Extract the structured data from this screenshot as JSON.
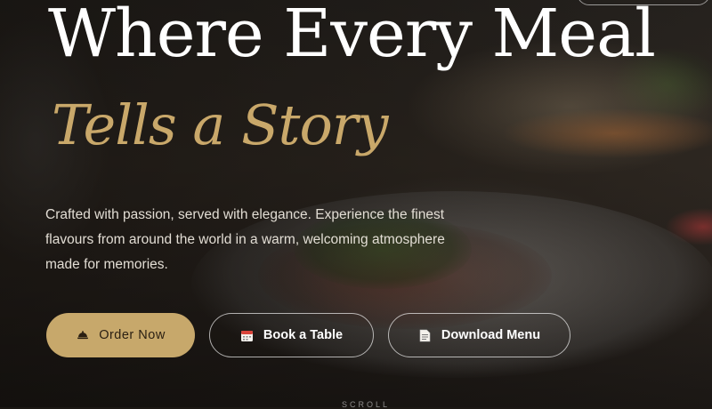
{
  "hero": {
    "title_line1": "Where Every Meal",
    "title_line2": "Tells a Story",
    "description": "Crafted with passion, served with elegance. Experience the finest flavours from around the world in a warm, welcoming atmosphere made for memories.",
    "scroll_hint": "SCROLL"
  },
  "buttons": {
    "order": {
      "label": "Order Now",
      "icon": "dish-icon"
    },
    "book": {
      "label": "Book a Table",
      "icon": "calendar-icon"
    },
    "menu": {
      "label": "Download Menu",
      "icon": "document-icon"
    }
  },
  "colors": {
    "accent": "#c7a86b",
    "title_gold": "#c9a86a",
    "text_light": "#e2ddd4"
  }
}
